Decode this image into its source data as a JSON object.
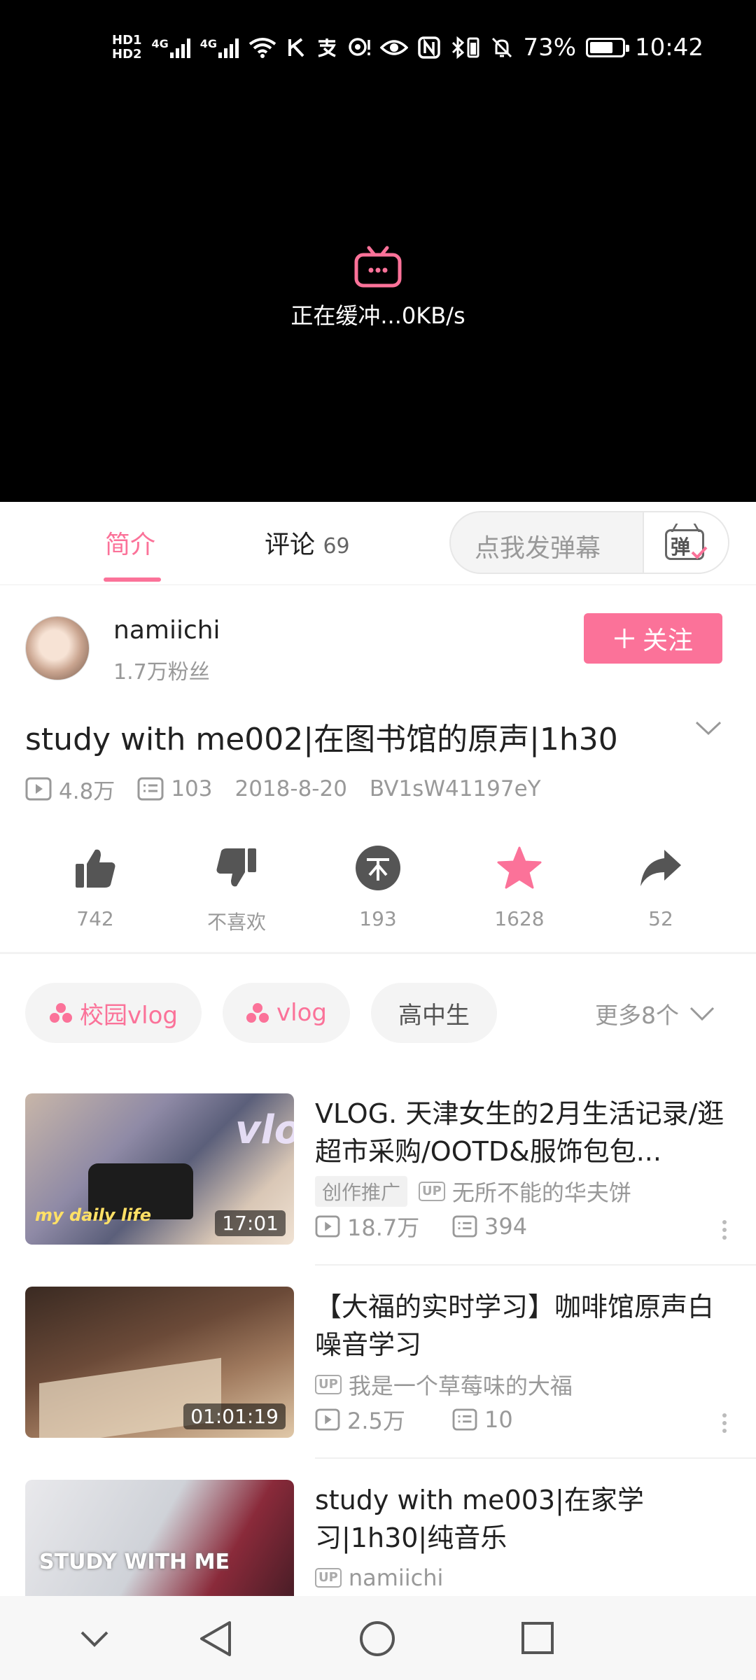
{
  "status_bar": {
    "hd1": "HD1",
    "hd2": "HD2",
    "net1": "4G",
    "net2": "4G",
    "battery_pct": "73%",
    "battery_level": 0.73,
    "time": "10:42"
  },
  "player": {
    "buffer_text": "正在缓冲...0KB/s"
  },
  "tabs": {
    "intro": "简介",
    "comments_label": "评论",
    "comments_count": "69",
    "danmaku_placeholder": "点我发弹幕",
    "danmaku_btn": "弹"
  },
  "uploader": {
    "name": "namiichi",
    "fans": "1.7万粉丝",
    "follow_label": "关注"
  },
  "video": {
    "title": "study with me002|在图书馆的原声|1h30",
    "views": "4.8万",
    "danmaku": "103",
    "date": "2018-8-20",
    "bvid": "BV1sW41197eY"
  },
  "actions": {
    "like": "742",
    "dislike": "不喜欢",
    "coin": "193",
    "favorite": "1628",
    "share": "52"
  },
  "tags": [
    {
      "label": "校园vlog"
    },
    {
      "label": "vlog"
    },
    {
      "label": "高中生"
    }
  ],
  "more_tags": "更多8个",
  "recommendations": [
    {
      "title": "VLOG. 天津女生的2月生活记录/逛超市采购/OOTD&服饰包包...",
      "badge": "创作推广",
      "up_tag": "UP",
      "uploader": "无所不能的华夫饼",
      "views": "18.7万",
      "danmaku": "394",
      "duration": "17:01",
      "thumb_text": "my daily life",
      "thumb_overlay": "vlog"
    },
    {
      "title": "【大福的实时学习】咖啡馆原声白噪音学习",
      "up_tag": "UP",
      "uploader": "我是一个草莓味的大福",
      "views": "2.5万",
      "danmaku": "10",
      "duration": "01:01:19"
    },
    {
      "title": "study with me003|在家学习|1h30|纯音乐",
      "up_tag": "UP",
      "uploader": "namiichi",
      "thumb_text": "STUDY WITH ME"
    }
  ],
  "colors": {
    "accent": "#fb7299",
    "video_bg": "#000000"
  }
}
